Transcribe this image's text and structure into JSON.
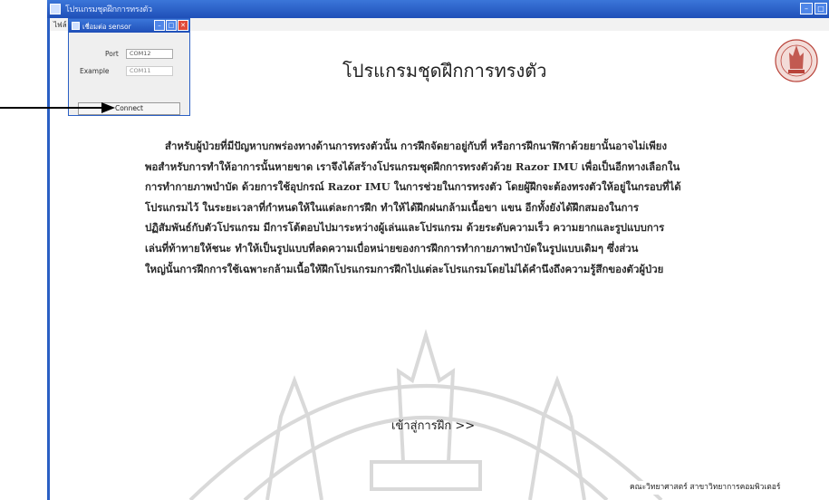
{
  "window": {
    "title": "โปรแกรมชุดฝึกการทรงตัว",
    "menu_label": "ไฟล์"
  },
  "dialog": {
    "title": "เชื่อมต่อ sensor",
    "port_label": "Port",
    "port_value": "COM12",
    "example_label": "Example",
    "example_value": "COM11",
    "connect_label": "Connect"
  },
  "main": {
    "title": "โปรแกรมชุดฝึกการทรงตัว",
    "paragraph_lines": [
      "สำหรับผู้ป่วยที่มีปัญหาบกพร่องทางด้านการทรงตัวนั้น การฝึกจัดยาอยู่กับที่ หรือการฝึกนาฬิกาด้วยยานั้นอาจไม่เพียง",
      "พอสำหรับการทำให้อาการนั้นหายขาด เราจึงได้สร้างโปรแกรมชุดฝึกการทรงตัวด้วย Razor IMU เพื่อเป็นอีกทางเลือกใน",
      "การทำกายภาพบำบัด ด้วยการใช้อุปกรณ์ Razor IMU ในการช่วยในการทรงตัว โดยผู้ฝึกจะต้องทรงตัวให้อยู่ในกรอบที่ได้",
      "โปรแกรมไว้ ในระยะเวลาที่กำหนดให้ในแต่ละการฝึก ทำให้ได้ฝึกฝนกล้ามเนื้อขา แขน อีกทั้งยังได้ฝึกสมองในการ",
      "ปฏิสัมพันธ์กับตัวโปรแกรม มีการโต้ตอบไปมาระหว่างผู้เล่นและโปรแกรม ด้วยระดับความเร็ว ความยากและรูปแบบการ",
      "เล่นที่ท้าทายให้ชนะ ทำให้เป็นรูปแบบที่ลดความเบื่อหน่ายของการฝึกการทำกายภาพบำบัดในรูปแบบเดิมๆ ซึ่งส่วน",
      "ใหญ่นั้นการฝึกการใช้เฉพาะกล้ามเนื้อให้ฝึกโปรแกรมการฝึกไปแต่ละโปรแกรมโดยไม่ได้คำนึงถึงความรู้สึกของตัวผู้ป่วย"
    ],
    "enter_button": "เข้าสู่การฝึก >>"
  },
  "footer": {
    "text": "คณะวิทยาศาสตร์ สาขาวิทยาการคอมพิวเตอร์"
  },
  "colors": {
    "titlebar": "#2a5fc4",
    "close": "#e04a3a",
    "emblem": "#b9433a"
  }
}
